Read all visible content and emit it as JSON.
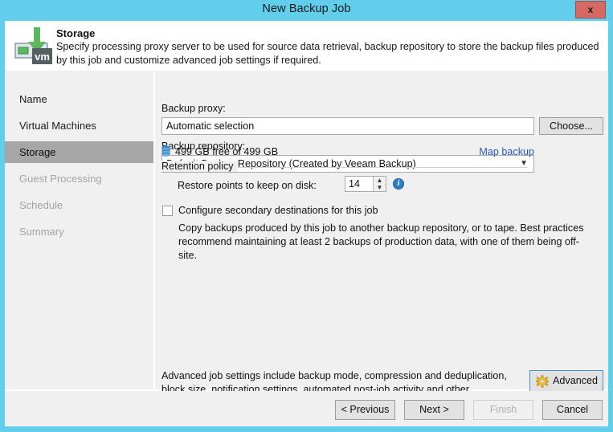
{
  "window": {
    "title": "New Backup Job",
    "close_label": "x",
    "accent_color": "#63cdec",
    "close_color": "#d66a63"
  },
  "header": {
    "icon": "vm-storage-icon",
    "title": "Storage",
    "description": "Specify processing proxy server to be used for source data retrieval, backup repository to store the backup files produced by this job and customize advanced job settings if required."
  },
  "sidebar": {
    "items": [
      {
        "label": "Name",
        "state": "done"
      },
      {
        "label": "Virtual Machines",
        "state": "done"
      },
      {
        "label": "Storage",
        "state": "active"
      },
      {
        "label": "Guest Processing",
        "state": "pending"
      },
      {
        "label": "Schedule",
        "state": "pending"
      },
      {
        "label": "Summary",
        "state": "pending"
      }
    ]
  },
  "main": {
    "backup_proxy": {
      "label": "Backup proxy:",
      "value": "Automatic selection",
      "placeholder": "Automatic selection",
      "choose_label": "Choose..."
    },
    "backup_repository": {
      "label": "Backup repository:",
      "selected": "Default Backup Repository (Created by Veeam Backup)",
      "chevron": "chevron-down-icon",
      "free_space": "499 GB free of 499 GB",
      "map_backup_label": "Map backup",
      "link_color": "#2a5ab5"
    },
    "retention": {
      "group_label": "Retention policy",
      "restore_points_label": "Restore points to keep on disk:",
      "restore_points_value": "14",
      "info_tooltip": "i"
    },
    "secondary": {
      "checkbox_label": "Configure secondary destinations for this job",
      "checked": false,
      "note": "Copy backups produced by this job to another backup repository, or to tape. Best practices recommend maintaining at least 2 backups of production data, with one of them being off-site."
    },
    "advanced": {
      "description": "Advanced job settings include backup mode, compression and deduplication, block size, notification settings, automated post-job activity and other settings.",
      "button_label": "Advanced",
      "icon": "gear-icon"
    }
  },
  "footer": {
    "buttons": [
      {
        "label": "< Previous",
        "enabled": true
      },
      {
        "label": "Next >",
        "enabled": true
      },
      {
        "label": "Finish",
        "enabled": false
      },
      {
        "label": "Cancel",
        "enabled": true
      }
    ]
  }
}
